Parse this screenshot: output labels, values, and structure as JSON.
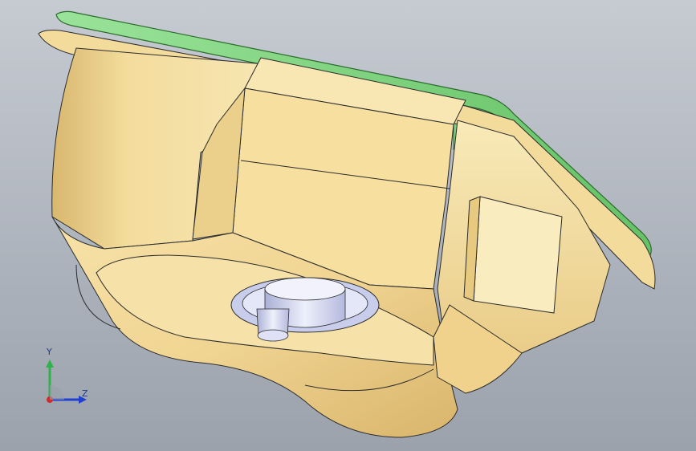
{
  "viewport": {
    "background_top": "#c6cbd2",
    "background_bottom": "#9ba2ac"
  },
  "model": {
    "body_color": "#f0d492",
    "body_shade": "#d8b56a",
    "body_highlight": "#fff1c6",
    "edge_color": "#2b2b2b",
    "flange_color": "#7fd37f",
    "flange_edge": "#2c6b2c",
    "shaft_color": "#d8dcf2",
    "shaft_shade": "#aab0d6",
    "icons": [
      "part-body",
      "flange-plate",
      "motor-shaft"
    ]
  },
  "triad": {
    "y_label": "Y",
    "z_label": "Z",
    "y_color": "#2fb24a",
    "z_color": "#1f3fd0",
    "x_color": "#d12b2b"
  }
}
